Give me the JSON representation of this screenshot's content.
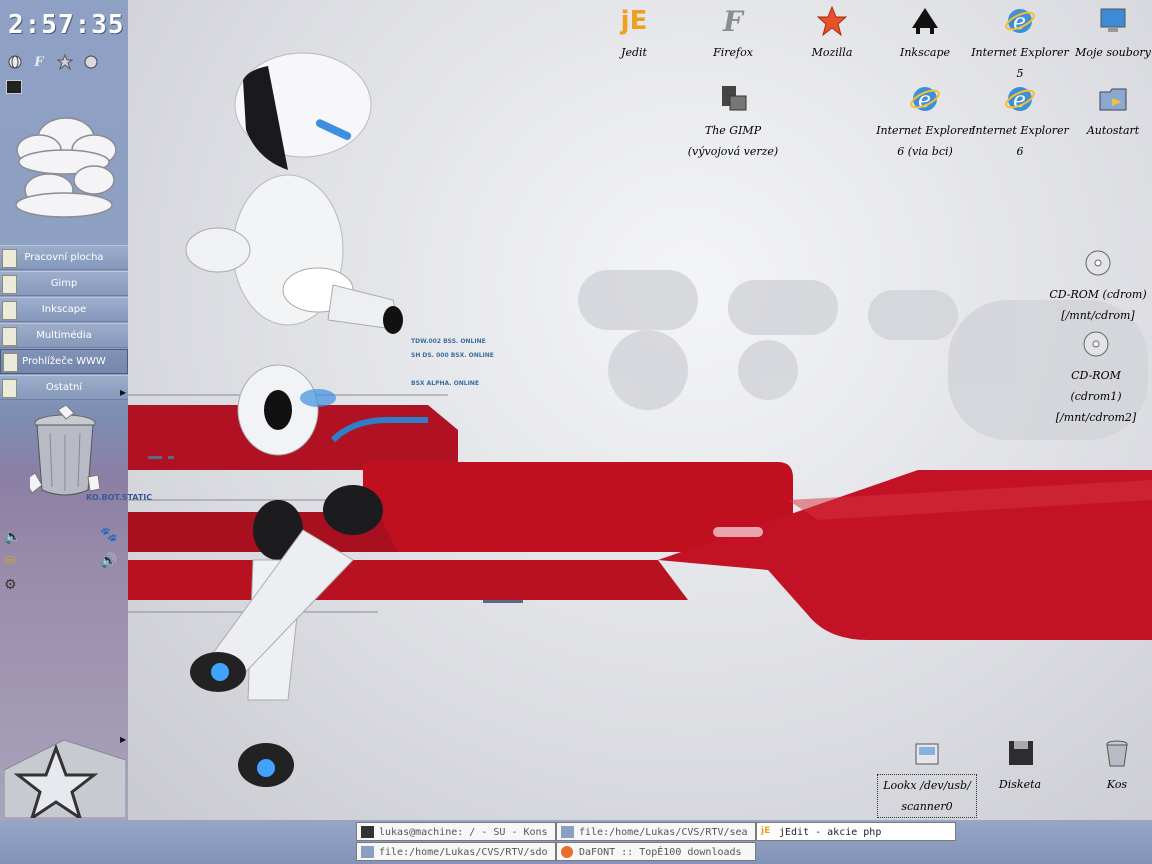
{
  "clock": "2:57:35",
  "panel": {
    "launchers": [
      "globe-icon",
      "firefox-f-icon",
      "mozilla-star-icon",
      "world-icon"
    ],
    "desktops": [
      {
        "label": "Pracovní plocha",
        "active": false
      },
      {
        "label": "Gimp",
        "active": false
      },
      {
        "label": "Inkscape",
        "active": false
      },
      {
        "label": "Multimédia",
        "active": false
      },
      {
        "label": "Prohlížeče WWW",
        "active": true
      },
      {
        "label": "Ostatní",
        "active": false
      }
    ],
    "wallpaper_text": "KO.BOT.STATIC"
  },
  "desktop_icons": [
    {
      "label": "Jedit",
      "icon": "jedit-icon"
    },
    {
      "label": "Firefox",
      "icon": "firefox-icon"
    },
    {
      "label": "Mozilla",
      "icon": "mozilla-icon"
    },
    {
      "label": "Inkscape",
      "icon": "inkscape-icon"
    },
    {
      "label": "Internet Explorer 5",
      "icon": "ie-icon"
    },
    {
      "label": "Moje soubory",
      "icon": "monitor-icon"
    },
    {
      "label": "The GIMP (vývojová verze)",
      "icon": "gimp-icon"
    },
    {
      "label": "Internet Explorer 6 (via bci)",
      "icon": "ie-icon"
    },
    {
      "label": "Internet Explorer 6",
      "icon": "ie-icon"
    },
    {
      "label": "Autostart",
      "icon": "autostart-folder-icon"
    },
    {
      "label": "CD-ROM (cdrom) [/mnt/cdrom]",
      "icon": "cdrom-icon"
    },
    {
      "label": "CD-ROM (cdrom1) [/mnt/cdrom2]",
      "icon": "cdrom-icon"
    },
    {
      "label": "Lookx /dev/usb/ scanner0",
      "icon": "scanner-icon"
    },
    {
      "label": "Disketa",
      "icon": "floppy-icon"
    },
    {
      "label": "Kos",
      "icon": "trash-icon"
    }
  ],
  "wallpaper_texts": [
    "TDW.002 BSS. ONLINE",
    "SH DS. 000 BSX. ONLINE",
    "BSX ALPHA. ONLINE"
  ],
  "taskbar": {
    "tasks": [
      {
        "label": "lukas@machine: / - SU - Kons",
        "icon": "terminal-icon"
      },
      {
        "label": "file:/home/Lukas/CVS/RTV/sea",
        "icon": "folder-icon"
      },
      {
        "label": "jEdit - akcie php",
        "icon": "jedit-icon"
      },
      {
        "label": "file:/home/Lukas/CVS/RTV/sdo",
        "icon": "folder-icon"
      },
      {
        "label": "DaFONT :: TopÉ100 downloads",
        "icon": "firefox-icon"
      }
    ]
  },
  "colors": {
    "panel": "#8fa1c2",
    "wallpaper_red": "#c01020",
    "accent_blue": "#3f8fd8"
  }
}
